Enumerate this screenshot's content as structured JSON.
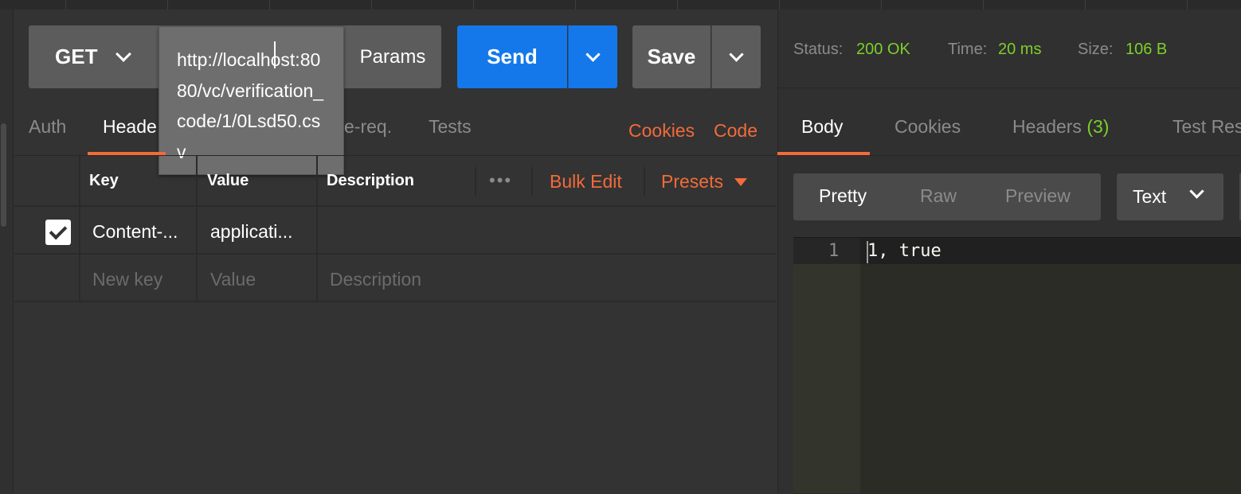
{
  "request": {
    "method": "GET",
    "url": "http://localhost:8080/vc/verification_code/1/0Lsd50.csv",
    "params_label": "Params",
    "send_label": "Send",
    "save_label": "Save"
  },
  "request_tabs": {
    "auth": "Auth",
    "headers": "Heade",
    "prereq": "e-req.",
    "tests": "Tests",
    "cookies": "Cookies",
    "code": "Code"
  },
  "headers_table": {
    "columns": {
      "key": "Key",
      "value": "Value",
      "description": "Description"
    },
    "more": "•••",
    "bulk_edit": "Bulk Edit",
    "presets": "Presets",
    "rows": [
      {
        "key": "Content-...",
        "value": "applicati...",
        "description": ""
      }
    ],
    "placeholders": {
      "key": "New key",
      "value": "Value",
      "description": "Description"
    }
  },
  "response": {
    "status_label": "Status:",
    "status_value": "200 OK",
    "time_label": "Time:",
    "time_value": "20 ms",
    "size_label": "Size:",
    "size_value": "106 B",
    "tabs": {
      "body": "Body",
      "cookies": "Cookies",
      "headers": "Headers",
      "headers_count": "(3)",
      "tests": "Test Res"
    },
    "view_options": {
      "pretty": "Pretty",
      "raw": "Raw",
      "preview": "Preview"
    },
    "format": "Text",
    "line_number": "1",
    "body_text": "1, true"
  },
  "colors": {
    "accent_orange": "#f26b3a",
    "send_blue": "#1478ea",
    "status_green": "#7ccf2a",
    "background": "#333333"
  },
  "icons": [
    "chevron-down-icon",
    "checkmark-icon",
    "caret-down-icon",
    "more-dots-icon"
  ]
}
